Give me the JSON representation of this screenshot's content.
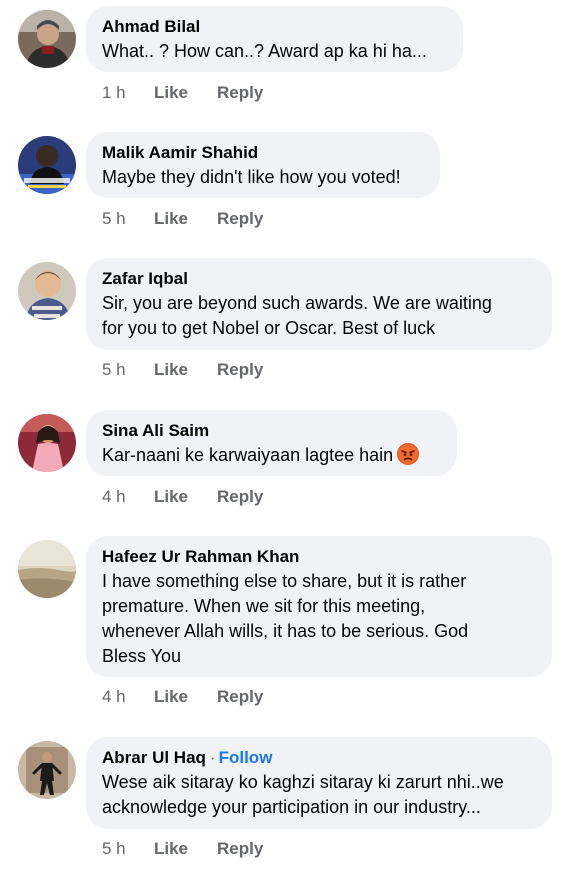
{
  "actions": {
    "like_label": "Like",
    "reply_label": "Reply"
  },
  "comments": [
    {
      "author": "Ahmad Bilal",
      "lines": [
        "What.. ? How can..? Award ap ka hi ha..."
      ],
      "time": "1 h"
    },
    {
      "author": "Malik Aamir Shahid",
      "lines": [
        "Maybe they didn't like how you voted!"
      ],
      "time": "5 h"
    },
    {
      "author": "Zafar Iqbal",
      "lines": [
        "Sir, you are beyond such awards. We are waiting",
        "for you to get Nobel or Oscar. Best of luck"
      ],
      "time": "5 h"
    },
    {
      "author": "Sina Ali Saim",
      "lines": [
        "Kar-naani ke karwaiyaan lagtee hain"
      ],
      "emoji": "angry-face-icon",
      "time": "4 h"
    },
    {
      "author": "Hafeez Ur Rahman Khan",
      "lines": [
        "I have something else to share, but it is rather",
        "premature. When we sit for this meeting,",
        "whenever Allah wills, it has to be serious. God",
        "Bless You"
      ],
      "time": "4 h"
    },
    {
      "author": "Abrar Ul Haq",
      "follow_separator": "·",
      "follow_label": "Follow",
      "lines": [
        "Wese aik sitaray ko kaghzi sitaray ki zarurt nhi..we",
        "acknowledge your participation in our industry..."
      ],
      "time": "5 h"
    }
  ],
  "colors": {
    "bubble": "#f0f2f5",
    "meta": "#65676b",
    "link": "#1877f2"
  }
}
